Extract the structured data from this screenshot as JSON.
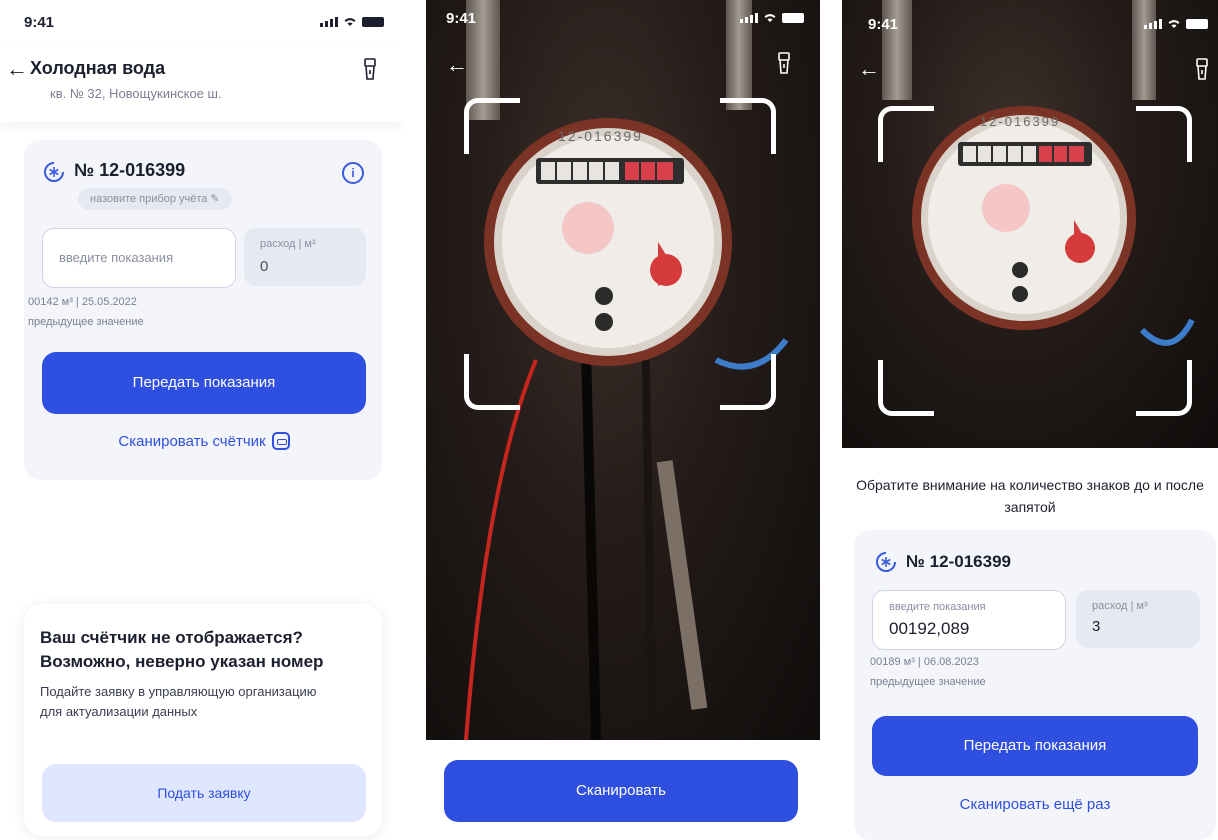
{
  "status_time": "9:41",
  "screen1": {
    "title": "Холодная вода",
    "address": "кв. № 32, Новощукинское ш.",
    "meter_number": "№ 12-016399",
    "name_prompt": "назовите прибор учёта ✎",
    "info_glyph": "i",
    "reading_placeholder": "введите показания",
    "usage_label": "расход | м³",
    "usage_value": "0",
    "previous_value": "00142 м³ | 25.05.2022",
    "previous_caption": "предыдущее значение",
    "submit_label": "Передать показания",
    "scan_label": "Сканировать счётчик",
    "notice_title": "Ваш счётчик не отображается? Возможно, неверно указан номер",
    "notice_text": "Подайте заявку в управляющую организацию для актуализации данных",
    "request_label": "Подать заявку"
  },
  "screen2": {
    "meter_label": "12-016399",
    "scan_button": "Сканировать"
  },
  "screen3": {
    "meter_label": "12-016399",
    "hint": "Обратите внимание на количество знаков до и после запятой",
    "meter_number": "№ 12-016399",
    "reading_label": "введите показания",
    "reading_value": "00192,089",
    "usage_label": "расход | м³",
    "usage_value": "3",
    "previous_value": "00189 м³ | 06.08.2023",
    "previous_caption": "предыдущее значение",
    "submit_label": "Передать показания",
    "rescan_label": "Сканировать ещё раз"
  },
  "icons": [
    "back-arrow-icon",
    "flashlight-icon",
    "snowflake-icon",
    "info-icon",
    "pencil-icon",
    "scan-icon"
  ],
  "colors": {
    "primary": "#2f4fe0",
    "card_bg": "#f3f5fb",
    "secondary_btn": "#dfe6ff"
  }
}
